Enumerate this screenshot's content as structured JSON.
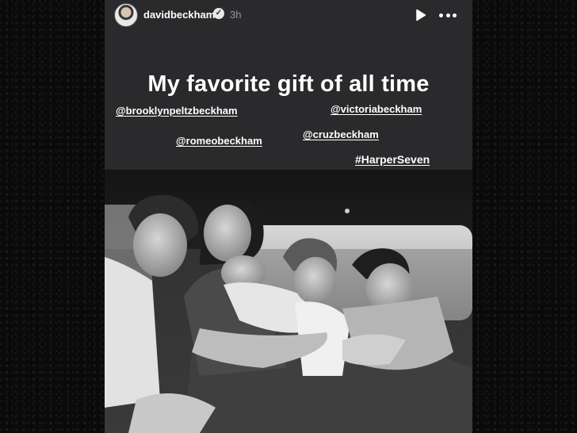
{
  "story": {
    "username": "davidbeckham",
    "time_ago": "3h",
    "caption": "My favorite gift of all time",
    "mentions": [
      "@brooklynpeltzbeckham",
      "@victoriabeckham",
      "@cruzbeckham",
      "@romeobeckham"
    ],
    "hashtag": "#HarperSeven"
  },
  "icons": {
    "verified": "verified-badge-icon",
    "play": "play-icon",
    "more": "more-options-icon"
  },
  "colors": {
    "story_background": "#2a2a2c",
    "page_background": "#080808",
    "text": "#ffffff",
    "timestamp": "#9a9a9a"
  }
}
